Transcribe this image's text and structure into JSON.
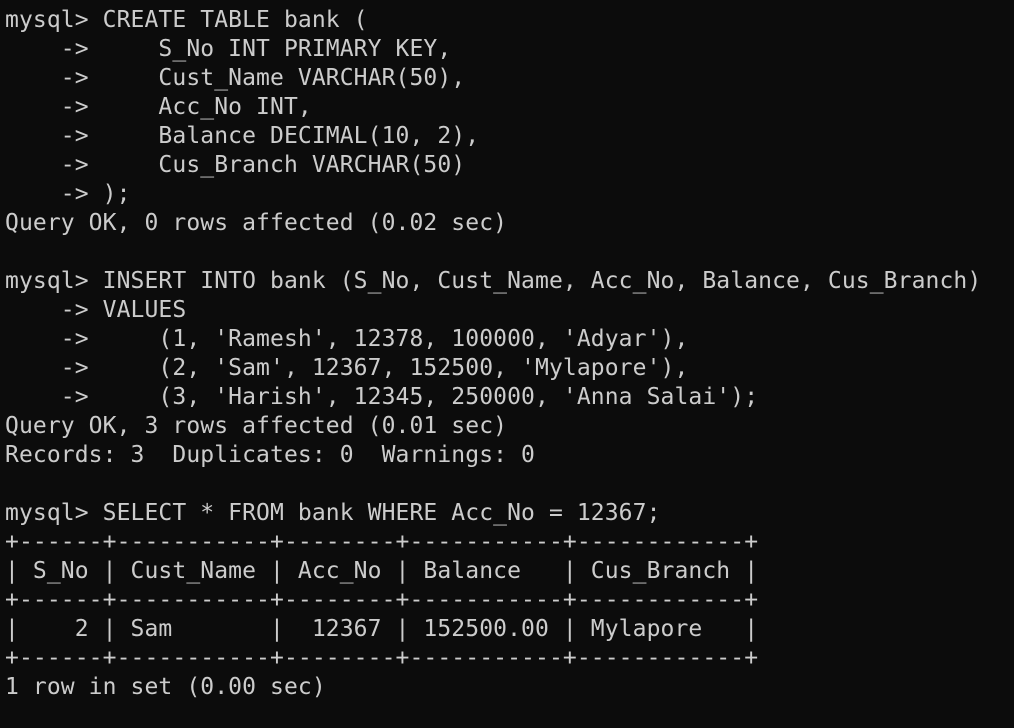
{
  "terminal": {
    "colors": {
      "background": "#0c0c0c",
      "foreground": "#cccccc"
    },
    "lines": [
      "mysql> CREATE TABLE bank (",
      "    ->     S_No INT PRIMARY KEY,",
      "    ->     Cust_Name VARCHAR(50),",
      "    ->     Acc_No INT,",
      "    ->     Balance DECIMAL(10, 2),",
      "    ->     Cus_Branch VARCHAR(50)",
      "    -> );",
      "Query OK, 0 rows affected (0.02 sec)",
      "",
      "mysql> INSERT INTO bank (S_No, Cust_Name, Acc_No, Balance, Cus_Branch)",
      "    -> VALUES",
      "    ->     (1, 'Ramesh', 12378, 100000, 'Adyar'),",
      "    ->     (2, 'Sam', 12367, 152500, 'Mylapore'),",
      "    ->     (3, 'Harish', 12345, 250000, 'Anna Salai');",
      "Query OK, 3 rows affected (0.01 sec)",
      "Records: 3  Duplicates: 0  Warnings: 0",
      "",
      "mysql> SELECT * FROM bank WHERE Acc_No = 12367;",
      "+------+-----------+--------+-----------+------------+",
      "| S_No | Cust_Name | Acc_No | Balance   | Cus_Branch |",
      "+------+-----------+--------+-----------+------------+",
      "|    2 | Sam       |  12367 | 152500.00 | Mylapore   |",
      "+------+-----------+--------+-----------+------------+",
      "1 row in set (0.00 sec)"
    ]
  }
}
